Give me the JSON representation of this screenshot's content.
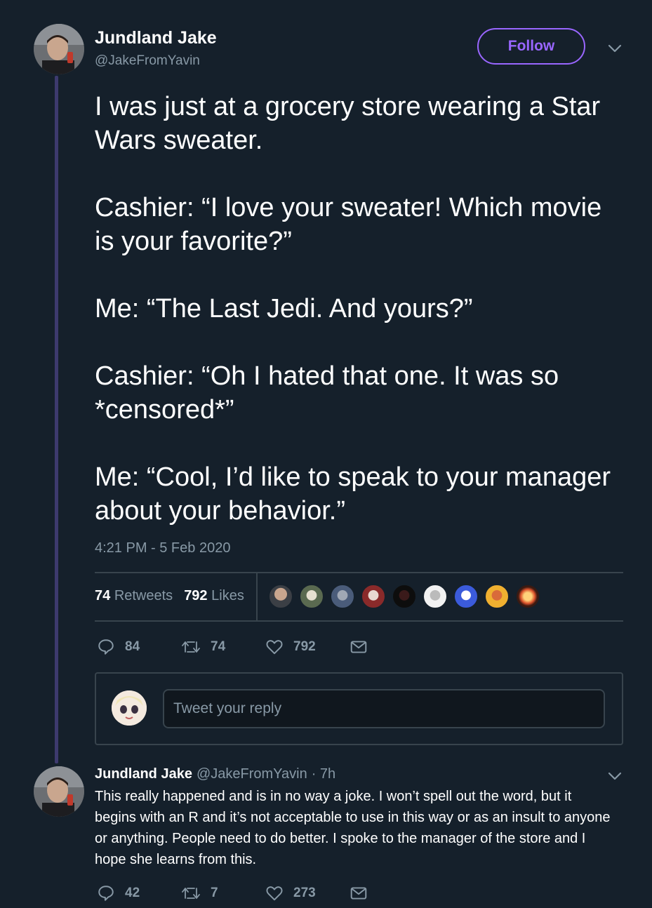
{
  "tweet": {
    "author_name": "Jundland Jake",
    "author_handle": "@JakeFromYavin",
    "follow_label": "Follow",
    "paragraphs": [
      "I was just at a grocery store wearing a Star Wars sweater.",
      "Cashier: “I love your sweater! Which movie is your favorite?”",
      "Me: “The Last Jedi. And yours?”",
      "Cashier: “Oh I hated that one. It was so *censored*”",
      "Me: “Cool, I’d like to speak to your manager about your behavior.”"
    ],
    "timestamp": "4:21 PM - 5 Feb 2020",
    "retweets_count": "74",
    "retweets_label": "Retweets",
    "likes_count": "792",
    "likes_label": "Likes",
    "actions": {
      "reply_count": "84",
      "retweet_count": "74",
      "like_count": "792"
    }
  },
  "reply_box": {
    "placeholder": "Tweet your reply"
  },
  "reply": {
    "author_name": "Jundland Jake",
    "author_handle": "@JakeFromYavin",
    "time": "· 7h",
    "text": "This really happened and is in no way a joke. I won’t spell out the word, but it begins with an R and it’s not acceptable to use in this way or as an insult to anyone or anything. People need to do better. I spoke to the manager of the store and I hope she learns from this.",
    "actions": {
      "reply_count": "42",
      "retweet_count": "7",
      "like_count": "273"
    }
  },
  "colors": {
    "background": "#15202b",
    "accent": "#9966ff",
    "muted_text": "#8899a6",
    "border": "#38444d"
  },
  "icons": [
    "avatar-photo",
    "chevron-down-icon",
    "reply-icon",
    "retweet-icon",
    "heart-icon",
    "mail-icon"
  ]
}
